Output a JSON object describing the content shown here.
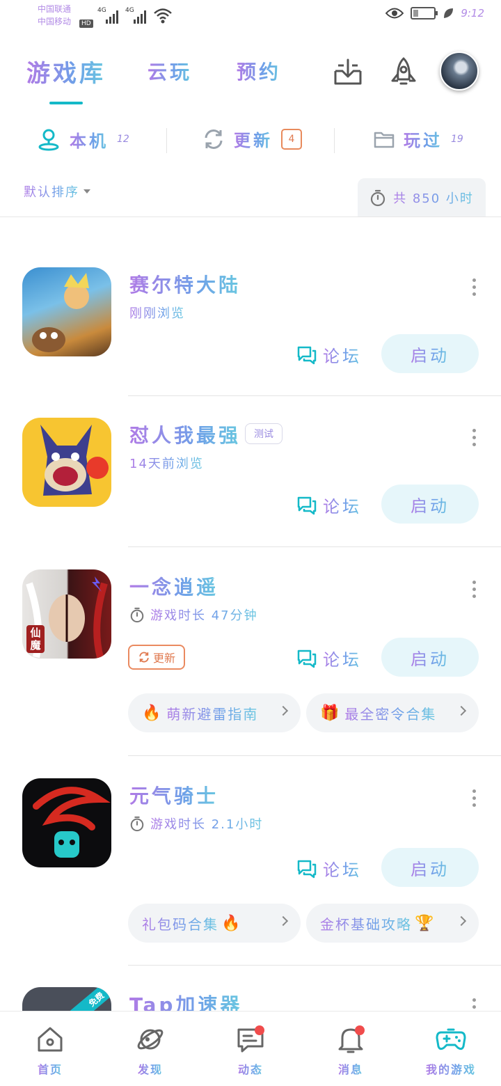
{
  "status_bar": {
    "carrier_1": "中国联通",
    "carrier_2": "中国移动",
    "hd": "HD",
    "net_1": "4G",
    "net_2": "4G",
    "battery_level": 0.2,
    "time": "9:12"
  },
  "header": {
    "tabs": [
      {
        "label": "游戏库",
        "active": true
      },
      {
        "label": "云玩",
        "active": false
      },
      {
        "label": "预约",
        "active": false
      }
    ],
    "download_icon": "download-tray-icon",
    "rocket_icon": "rocket-icon",
    "avatar": "user-avatar"
  },
  "subtabs": [
    {
      "label": "本机",
      "count": "12",
      "icon": "location-icon"
    },
    {
      "label": "更新",
      "count": "4",
      "icon": "refresh-icon"
    },
    {
      "label": "玩过",
      "count": "19",
      "icon": "folder-icon"
    }
  ],
  "sort_label": "默认排序",
  "total_label": "共 850 小时",
  "games": [
    {
      "name": "赛尔特大陆",
      "sub": "刚刚浏览",
      "forum": "论坛",
      "launch": "启动",
      "colors": [
        "#4aa3d8",
        "#e8b45a"
      ]
    },
    {
      "name": "怼人我最强",
      "tag": "测试",
      "sub": "14天前浏览",
      "forum": "论坛",
      "launch": "启动",
      "colors": [
        "#f7c531",
        "#3d3f8e"
      ]
    },
    {
      "name": "一念逍遥",
      "sub": "游戏时长 47分钟",
      "update": "更新",
      "forum": "论坛",
      "launch": "启动",
      "chips": [
        {
          "emoji": "🔥",
          "label": "萌新避雷指南",
          "emoji_first": true
        },
        {
          "emoji": "🎁",
          "label": "最全密令合集",
          "emoji_first": true
        }
      ],
      "icon_text": "仙魔"
    },
    {
      "name": "元气骑士",
      "sub": "游戏时长 2.1小时",
      "forum": "论坛",
      "launch": "启动",
      "chips": [
        {
          "emoji": "🔥",
          "label": "礼包码合集",
          "emoji_first": false
        },
        {
          "emoji": "🏆",
          "label": "金杯基础攻略",
          "emoji_first": true
        }
      ]
    },
    {
      "name": "Tap加速器",
      "badge": "免费"
    }
  ],
  "bottom_nav": [
    {
      "label": "首页",
      "icon": "home-icon",
      "dot": false
    },
    {
      "label": "发现",
      "icon": "planet-icon",
      "dot": false
    },
    {
      "label": "动态",
      "icon": "chat-icon",
      "dot": true
    },
    {
      "label": "消息",
      "icon": "bell-icon",
      "dot": true
    },
    {
      "label": "我的游戏",
      "icon": "gamepad-icon",
      "dot": false,
      "active": true
    }
  ]
}
